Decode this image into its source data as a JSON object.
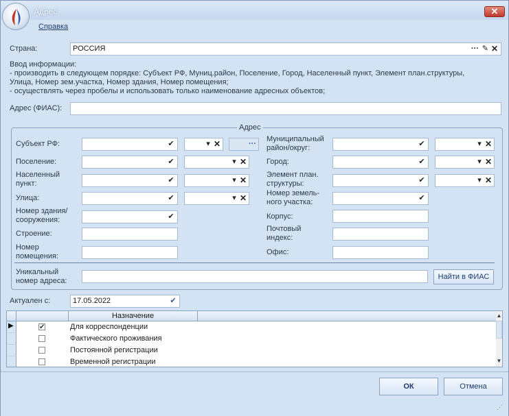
{
  "window": {
    "title": "Адрес",
    "close": "✕"
  },
  "menu": {
    "help": "Справка"
  },
  "country": {
    "label": "Страна:",
    "value": "РОССИЯ"
  },
  "info": {
    "title": "Ввод информации:",
    "line1": "- производить в следующем порядке: Субъект РФ, Муниц.район, Поселение, Город, Населенный пункт, Элемент план.структуры,",
    "line2": "Улица, Номер зем.участка, Номер здания, Номер помещения;",
    "line3": "- осуществлять через пробелы и использовать только наименование адресных объектов;"
  },
  "fias": {
    "label": "Адрес (ФИАС):",
    "value": ""
  },
  "address_group": {
    "legend": "Адрес",
    "subject": "Субъект РФ:",
    "settlement": "Поселение:",
    "locality1": "Населенный",
    "locality2": "пункт:",
    "street": "Улица:",
    "building1": "Номер здания/",
    "building2": "сооружения:",
    "structure": "Строение:",
    "room1": "Номер",
    "room2": "помещения:",
    "district1": "Муниципальный",
    "district2": "район/округ:",
    "city": "Город:",
    "plan1": "Элемент план.",
    "plan2": "структуры:",
    "land1": "Номер земель-",
    "land2": "ного участка:",
    "korpus": "Корпус:",
    "postal1": "Почтовый",
    "postal2": "индекс:",
    "office": "Офис:",
    "unique1": "Уникальный",
    "unique2": "номер адреса:",
    "find_button": "Найти в ФИАС"
  },
  "actual": {
    "label": "Актуален с:",
    "value": "17.05.2022"
  },
  "grid": {
    "header": "Назначение",
    "rows": [
      {
        "label": "Для корреспонденции",
        "checked": true
      },
      {
        "label": "Фактического проживания",
        "checked": false
      },
      {
        "label": "Постоянной регистрации",
        "checked": false
      },
      {
        "label": "Временной регистрации",
        "checked": false
      }
    ]
  },
  "buttons": {
    "ok": "ОК",
    "cancel": "Отмена"
  },
  "colors": {
    "window_bg": "#d4e3f4",
    "border": "#8aa3c2",
    "close_red": "#c0392b"
  }
}
